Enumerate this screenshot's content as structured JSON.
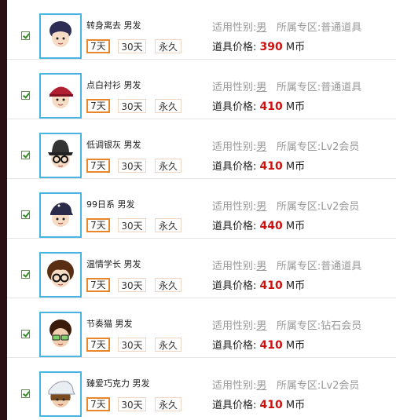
{
  "items": [
    {
      "name": "转身离去 男发",
      "gender_label": "适用性别:",
      "gender": "男",
      "zone_label": "所属专区:",
      "zone": "普通道具",
      "price_label": "道具价格:",
      "price": "390",
      "unit": "M币",
      "durations": [
        "7天",
        "30天",
        "永久"
      ],
      "hair": "#2d2d55",
      "hat": "none",
      "glasses": false
    },
    {
      "name": "点白衬衫 男发",
      "gender_label": "适用性别:",
      "gender": "男",
      "zone_label": "所属专区:",
      "zone": "普通道具",
      "price_label": "道具价格:",
      "price": "410",
      "unit": "M币",
      "durations": [
        "7天",
        "30天",
        "永久"
      ],
      "hair": "#b02030",
      "hat": "cap-red",
      "glasses": false
    },
    {
      "name": "低调银灰 男发",
      "gender_label": "适用性别:",
      "gender": "男",
      "zone_label": "所属专区:",
      "zone": "Lv2会员",
      "price_label": "道具价格:",
      "price": "410",
      "unit": "M币",
      "durations": [
        "7天",
        "30天",
        "永久"
      ],
      "hair": "#222222",
      "hat": "fedora",
      "glasses": true
    },
    {
      "name": "99日系 男发",
      "gender_label": "适用性别:",
      "gender": "男",
      "zone_label": "所属专区:",
      "zone": "Lv2会员",
      "price_label": "道具价格:",
      "price": "440",
      "unit": "M币",
      "durations": [
        "7天",
        "30天",
        "永久"
      ],
      "hair": "#2a2a4a",
      "hat": "cap-dark",
      "glasses": false
    },
    {
      "name": "温情学长 男发",
      "gender_label": "适用性别:",
      "gender": "男",
      "zone_label": "所属专区:",
      "zone": "普通道具",
      "price_label": "道具价格:",
      "price": "410",
      "unit": "M币",
      "durations": [
        "7天",
        "30天",
        "永久"
      ],
      "hair": "#5a2e12",
      "hat": "none",
      "glasses": true
    },
    {
      "name": "节奏猫 男发",
      "gender_label": "适用性别:",
      "gender": "男",
      "zone_label": "所属专区:",
      "zone": "钻石会员",
      "price_label": "道具价格:",
      "price": "410",
      "unit": "M币",
      "durations": [
        "7天",
        "30天",
        "永久"
      ],
      "hair": "#3a1a0a",
      "hat": "none",
      "glasses": true
    },
    {
      "name": "臻爱巧克力 男发",
      "gender_label": "适用性别:",
      "gender": "男",
      "zone_label": "所属专区:",
      "zone": "Lv2会员",
      "price_label": "道具价格:",
      "price": "410",
      "unit": "M币",
      "durations": [
        "7天",
        "30天",
        "永久"
      ],
      "hair": "#7a4a20",
      "hat": "cap-white",
      "glasses": false
    }
  ]
}
